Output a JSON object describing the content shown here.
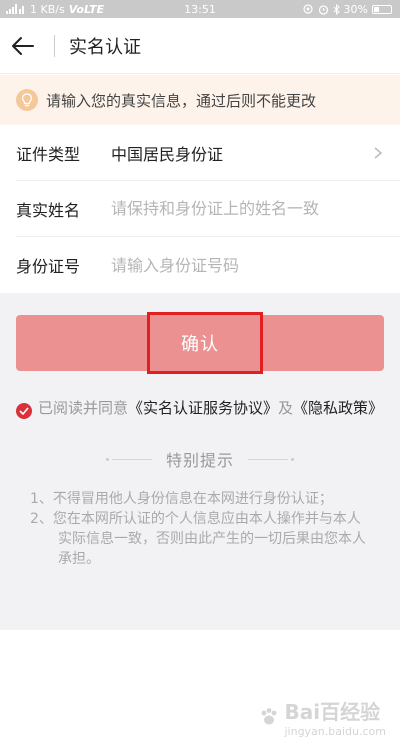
{
  "status_bar": {
    "network": "1 KB/s",
    "volte": "VoLTE",
    "time": "13:51",
    "battery": "30%"
  },
  "header": {
    "title": "实名认证"
  },
  "notice": {
    "text": "请输入您的真实信息，通过后则不能更改"
  },
  "form": {
    "id_type_label": "证件类型",
    "id_type_value": "中国居民身份证",
    "name_label": "真实姓名",
    "name_placeholder": "请保持和身份证上的姓名一致",
    "id_number_label": "身份证号",
    "id_number_placeholder": "请输入身份证号码"
  },
  "confirm_button": {
    "label": "确认"
  },
  "agreement": {
    "prefix": "已阅读并同意",
    "link1": "《实名认证服务协议》",
    "mid": "及",
    "link2": "《隐私政策》"
  },
  "tips": {
    "title": "特别提示",
    "items": [
      "1、不得冒用他人身份信息在本网进行身份认证；",
      "2、您在本网所认证的个人信息应由本人操作并与本人实际信息一致，否则由此产生的一切后果由您本人承担。"
    ]
  },
  "watermark": {
    "text": "Bai百经验",
    "sub": "jingyan.baidu.com"
  },
  "colors": {
    "confirm_bg": "#ec9191",
    "notice_bg": "#fdf3ea",
    "highlight": "#e02020",
    "check": "#d9303a"
  }
}
